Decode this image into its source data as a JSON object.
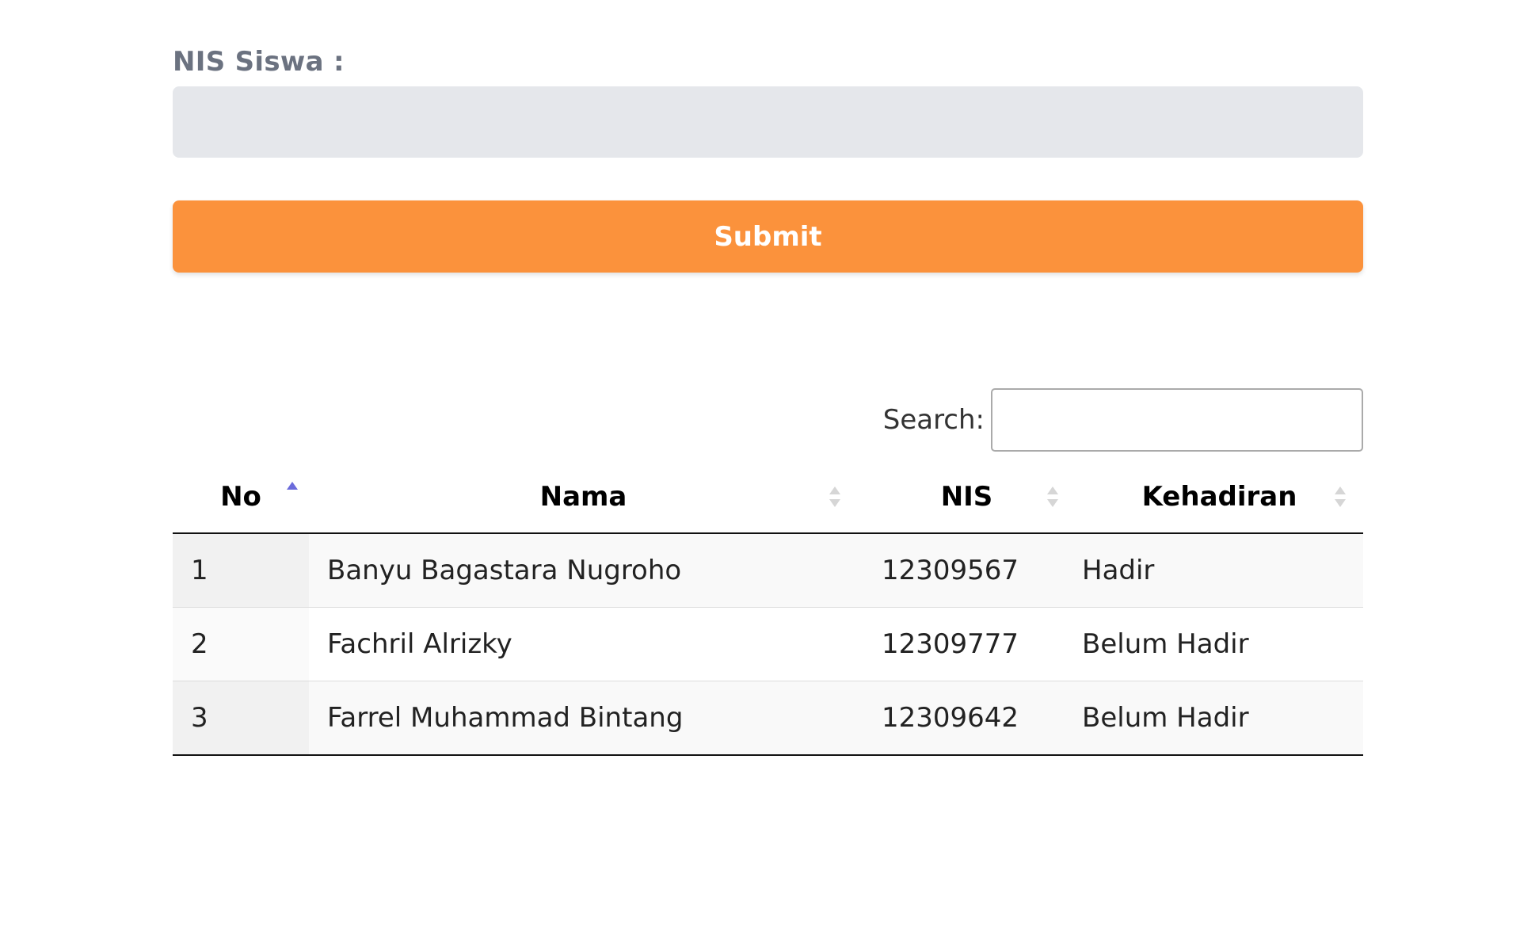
{
  "form": {
    "nis_label": "NIS Siswa :",
    "nis_value": "",
    "submit_label": "Submit"
  },
  "colors": {
    "submit_bg": "#fb923c",
    "input_bg": "#e5e7eb",
    "sort_active": "#6b6bdb",
    "sort_inactive": "#d6d6d6"
  },
  "table": {
    "search_label": "Search:",
    "search_value": "",
    "headers": [
      "No",
      "Nama",
      "NIS",
      "Kehadiran"
    ],
    "sorted_column": "No",
    "sort_direction": "asc",
    "rows": [
      {
        "no": "1",
        "nama": "Banyu Bagastara Nugroho",
        "nis": "12309567",
        "kehadiran": "Hadir"
      },
      {
        "no": "2",
        "nama": "Fachril Alrizky",
        "nis": "12309777",
        "kehadiran": "Belum Hadir"
      },
      {
        "no": "3",
        "nama": "Farrel Muhammad Bintang",
        "nis": "12309642",
        "kehadiran": "Belum Hadir"
      }
    ]
  }
}
